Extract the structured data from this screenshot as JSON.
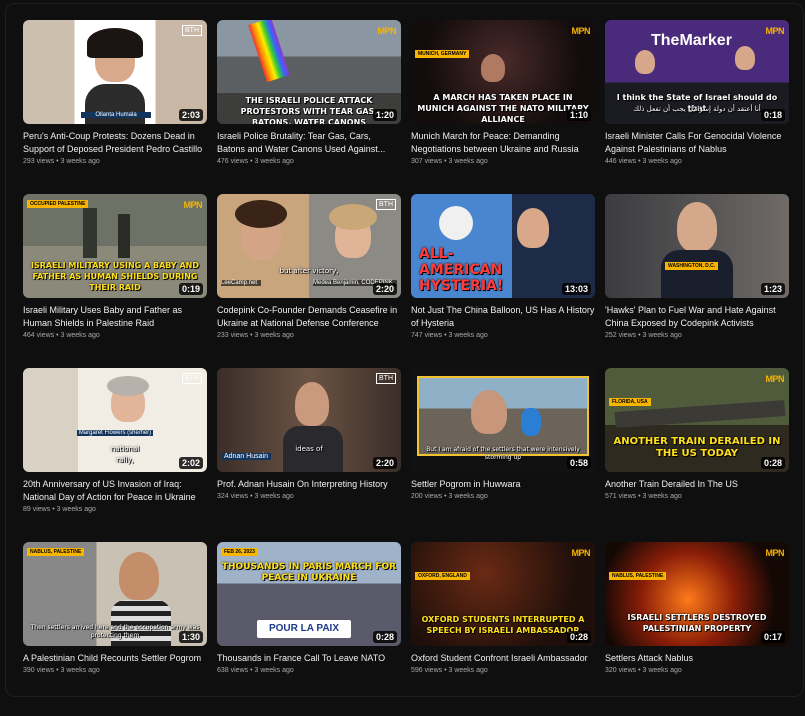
{
  "brand": {
    "logo_text": "MPN",
    "bth": "BTH"
  },
  "videos": [
    {
      "title": "Peru's Anti-Coup Protests: Dozens Dead in Support of Deposed President Pedro Castillo",
      "views": "293 views",
      "age": "3 weeks ago",
      "duration": "2:03",
      "caption": "",
      "sub": "Ollanta Humala"
    },
    {
      "title": "Israeli Police Brutality: Tear Gas, Cars, Batons and Water Canons Used Against...",
      "views": "476 views",
      "age": "3 weeks ago",
      "duration": "1:20",
      "caption": "THE ISRAELI POLICE ATTACK PROTESTORS WITH TEAR GAS, BATONS, WATER CANONS"
    },
    {
      "title": "Munich March for Peace: Demanding Negotiations between Ukraine and Russia",
      "views": "307 views",
      "age": "3 weeks ago",
      "duration": "1:10",
      "caption": "A MARCH HAS TAKEN PLACE IN MUNICH AGAINST THE NATO MILITARY ALLIANCE",
      "tag": "MUNICH, GERMANY"
    },
    {
      "title": "Israeli Minister Calls For Genocidal Violence Against Palestinians of Nablus",
      "views": "446 views",
      "age": "3 weeks ago",
      "duration": "0:18",
      "caption": "I think the State of Israel should do that",
      "sub": "أنا أعتقد أن دولة إسرائيل يجب أن تفعل ذلك",
      "banner": "TheMarker"
    },
    {
      "title": "Israeli Military Uses Baby and Father as Human Shields in Palestine Raid",
      "views": "464 views",
      "age": "3 weeks ago",
      "duration": "0:19",
      "caption": "ISRAELI MILITARY USING A BABY AND FATHER AS HUMAN SHIELDS DURING THEIR RAID",
      "tag": "OCCUPIED PALESTINE"
    },
    {
      "title": "Codepink Co-Founder Demands Ceasefire in Ukraine at National Defense Conference",
      "views": "233 views",
      "age": "3 weeks ago",
      "duration": "2:20",
      "caption": "but after victory,",
      "sub_left": "LeeCamp.net",
      "sub_right": "Medea Benjamin, CODEPINK"
    },
    {
      "title": "Not Just The China Balloon, US Has A History of Hysteria",
      "views": "747 views",
      "age": "3 weeks ago",
      "duration": "13:03",
      "caption": "ALL-AMERICAN HYSTERIA!"
    },
    {
      "title": "'Hawks' Plan to Fuel War and Hate Against China Exposed by Codepink Activists",
      "views": "252 views",
      "age": "3 weeks ago",
      "duration": "1:23",
      "caption": "",
      "tag": "WASHINGTON, D.C."
    },
    {
      "title": "20th Anniversary of US Invasion of Iraq: National Day of Action for Peace in Ukraine",
      "views": "89 views",
      "age": "3 weeks ago",
      "duration": "2:02",
      "caption": "national rally,",
      "sub": "Margaret Flowers (she/her)"
    },
    {
      "title": "Prof. Adnan Husain On Interpreting History",
      "views": "324 views",
      "age": "3 weeks ago",
      "duration": "2:20",
      "caption": "ideas of",
      "sub": "Adnan Husain"
    },
    {
      "title": "Settler Pogrom in Huwwara",
      "views": "200 views",
      "age": "3 weeks ago",
      "duration": "0:58",
      "caption": "But I am afraid of the settlers that were intensively storming up"
    },
    {
      "title": "Another Train Derailed In The US",
      "views": "571 views",
      "age": "3 weeks ago",
      "duration": "0:28",
      "caption": "ANOTHER TRAIN DERAILED IN THE US TODAY",
      "tag": "FLORIDA, USA"
    },
    {
      "title": "A Palestinian Child Recounts Settler Pogrom",
      "views": "390 views",
      "age": "3 weeks ago",
      "duration": "1:30",
      "caption": "Then settlers arrived here and the occupation army was protecting them",
      "tag": "NABLUS, PALESTINE"
    },
    {
      "title": "Thousands in France Call To Leave NATO",
      "views": "638 views",
      "age": "3 weeks ago",
      "duration": "0:28",
      "caption": "THOUSANDS IN PARIS MARCH FOR PEACE IN UKRAINE",
      "sign": "POUR LA PAIX",
      "tag": "FEB 26, 2023"
    },
    {
      "title": "Oxford Student Confront Israeli Ambassador",
      "views": "596 views",
      "age": "3 weeks ago",
      "duration": "0:28",
      "caption": "OXFORD STUDENTS INTERRUPTED A SPEECH BY ISRAELI AMBASSADOR",
      "tag": "OXFORD, ENGLAND"
    },
    {
      "title": "Settlers Attack Nablus",
      "views": "320 views",
      "age": "3 weeks ago",
      "duration": "0:17",
      "caption": "ISRAELI SETTLERS DESTROYED PALESTINIAN PROPERTY",
      "tag": "NABLUS, PALESTINE"
    }
  ],
  "separator": "•"
}
